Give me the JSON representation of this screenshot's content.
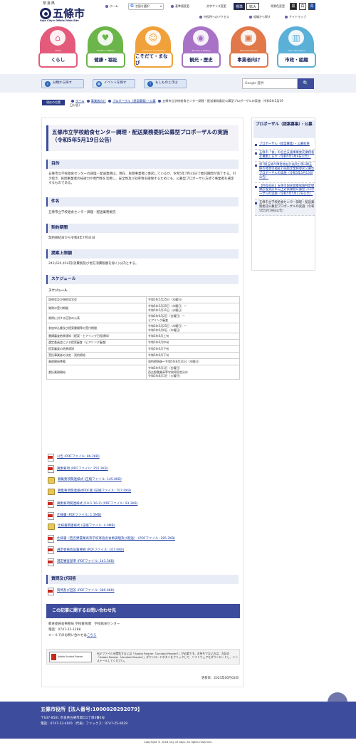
{
  "header": {
    "pref": "奈良県",
    "site_name": "五條市",
    "site_sub": "Gojo City's Official Web Site",
    "links": {
      "home": "ホーム",
      "translate": "言語を選択",
      "language": "Language",
      "font_size_label": "文字サイズ変更",
      "standard": "標準",
      "enlarge": "拡大",
      "color_label": "背景色変更",
      "color_blue": "黒",
      "color_white": "白",
      "color_black": "青",
      "access": "市役所へのアクセス",
      "find": "組織から探す",
      "sitemap": "サイトマップ",
      "bg_label": "基準値変更"
    }
  },
  "nav": [
    {
      "en": "Living",
      "label": "くらし",
      "icon": "house-icon",
      "color": "#e45a7b",
      "glyph": "⌂"
    },
    {
      "en": "Health & Welfare",
      "label": "健康・福祉",
      "icon": "stethoscope-icon",
      "color": "#6cb54a",
      "glyph": "♥"
    },
    {
      "en": "Childcare & Learning",
      "label": "こそだて・まなび",
      "icon": "child-icon",
      "color": "#f0a13a",
      "glyph": "☺"
    },
    {
      "en": "Tourism & History",
      "label": "観光・歴史",
      "icon": "camera-icon",
      "color": "#a873c6",
      "glyph": "◉"
    },
    {
      "en": "Business Person",
      "label": "事業者向け",
      "icon": "briefcase-icon",
      "color": "#e0784a",
      "glyph": "▣"
    },
    {
      "en": "City Information",
      "label": "市政・組織",
      "icon": "building-icon",
      "color": "#5bb0d8",
      "glyph": "▥"
    }
  ],
  "search": {
    "by_category": "分類から探す",
    "by_event": "イベントを探す",
    "by_purpose": "もしものときは",
    "google_placeholder": "Google 提供",
    "go": "🔍"
  },
  "breadcrumb": {
    "label": "現在の位置",
    "items": [
      "ホーム",
      "事業者向け",
      "プロポーザル（提案募集）・公募",
      "五條市立学校給食センター調理・配送業務委託公募型プロポーザルの実施（令和5年5月19日公告）"
    ]
  },
  "article": {
    "title": "五條市立学校給食センター調理・配送業務委託公募型プロポーザルの実施（令和5年5月19日公告）",
    "sections": {
      "purpose_h": "目的",
      "purpose_p": "五條市立学校給食センターの調理・配送業務は、現在、民間事業者に委託しているが、令和5年7月31日で委託期間が満了する。引き続き、民間事業者の技術力や専門性を活用し、安全性及び効率性を確保するためにも、公募型プロポーザル方式で事業者を選定するものである。",
      "name_h": "件名",
      "name_p": "五條市立学校給食センター調理・配送業務委託",
      "period_h": "契約期間",
      "period_p": "契約締結日から令和8年7月31日",
      "limit_h": "提案上限額",
      "limit_p": "243,624,454円(消費税及び地方消費税額を除く)以内とする。",
      "schedule_h": "スケジュール",
      "schedule_sub": "スケジュール"
    },
    "schedule": [
      {
        "item": "説明会及び現地見学会",
        "date": "令和5年5月25日（木曜日）"
      },
      {
        "item": "質問の受付期間",
        "date": "令和5年5月25日（木曜日）～\n令和5年5月31日（水曜日）"
      },
      {
        "item": "質問に対する回答の公表",
        "date": "令和5年6月2日（金曜日）～\nヒアリング審査"
      },
      {
        "item": "参加申込書及び提案書類等の受付期間",
        "date": "令和5年5月25日（木曜日）～\n令和5年6月8日（木曜日）"
      },
      {
        "item": "書類審査結果通知（提案・ヒアリング日程通知）",
        "date": "令和5年6月上旬"
      },
      {
        "item": "選定委員会による提案審査（ヒアリング審査）",
        "date": "令和5年6月中旬"
      },
      {
        "item": "提案審査の結果通知",
        "date": "令和5年6月下旬"
      },
      {
        "item": "受託事業者の決定・契約締結",
        "date": "令和5年6月下旬"
      },
      {
        "item": "業務開始準備",
        "date": "契約締結後～令和5年8月31日（木曜日）"
      },
      {
        "item": "委託業務開始",
        "date": "令和5年9月1日（金曜日）\n西吉野農業高等学校寄宿舎分は\n令和5年8月1日（火曜日）"
      }
    ],
    "files": [
      {
        "type": "pdf",
        "label": "公告 (PDFファイル: 86.2KB)"
      },
      {
        "type": "pdf",
        "label": "募集要項 (PDFファイル: 255.3KB)"
      },
      {
        "type": "zip",
        "label": "募集要項関連様式 (圧縮ファイル: 145.0KB)"
      },
      {
        "type": "zip",
        "label": "募集要項関連様式PDF版 (圧縮ファイル: 707.0KB)"
      },
      {
        "type": "pdf",
        "label": "募集要項関連様式 (10-1,10-2) (PDFファイル: 93.2KB)"
      },
      {
        "type": "pdf",
        "label": "仕様書 (PDFファイル: 1.5MB)"
      },
      {
        "type": "zip",
        "label": "仕様書関連様式 (圧縮ファイル: 4.0MB)"
      },
      {
        "type": "pdf",
        "label": "仕様書（西吉野農業高等学校寄宿舎食事調理及び配送） (PDFファイル: 185.2KB)"
      },
      {
        "type": "pdf",
        "label": "選定委員会設置要綱 (PDFファイル: 107.0KB)"
      },
      {
        "type": "pdf",
        "label": "選定審査基準 (PDFファイル: 141.3KB)"
      }
    ],
    "qa_h": "質問及び回答",
    "qa_file": "質問及び回答 (PDFファイル: 389.0KB)",
    "contact_h": "この記事に関するお問い合わせ先",
    "contact_lines": [
      "教育委員会事務局 学校教育課　学校給食センター",
      "電話：0747-22-1288",
      "メールでのお問い合わせは"
    ],
    "contact_link": "こちら",
    "reader_logo": "Adobe Acrobat Reader",
    "reader_text": "PDFファイルを閲覧するには「Adobe Reader（Acrobat Reader）」が必要です。お持ちでない方は、左記の「Adobe Reader（Acrobat Reader）」ダウンロードボタンをクリックして、ソフトウェアをダウンロードし、インストールしてください。",
    "updated": "更新日：2023年06月02日"
  },
  "side": {
    "title": "プロポーザル（提案募集）・公募",
    "items": [
      "プロポーザル（提案募集）・公募結果",
      "五條市「食」の自立支援事業委託業務者を募集します（令和5年3月6日公告）",
      "第7期五條市障害福祉計画及び第3期五條市障害児福祉計画策定業務委託公募型プロポーザルの実施（令和5年5月15日公告）",
      "【回答追記】五條市国民健康保険特定健康診査受診率向上対策業務公募型プロポーザルの実施（令和5年5月17日公告）",
      "五條市立学校給食センター調理・配送業務委託公募型プロポーザルの実施（令和5年5月19日公告）"
    ]
  },
  "footer": {
    "title": "五條市役所【法人番号:1000020292079】",
    "addr": "〒637-8501 奈良県五條市岡口1丁目3番1号",
    "tel": "電話：0747-22-4001（代表）ファックス：0747-25-0629",
    "copyright": "Copyright © 2018 City of Gojo. All rights reserved.",
    "pagetop": "︿"
  },
  "colors": {
    "primary": "#3d4c9c",
    "dark": "#1b2660",
    "footer": "#3d4c9c"
  }
}
